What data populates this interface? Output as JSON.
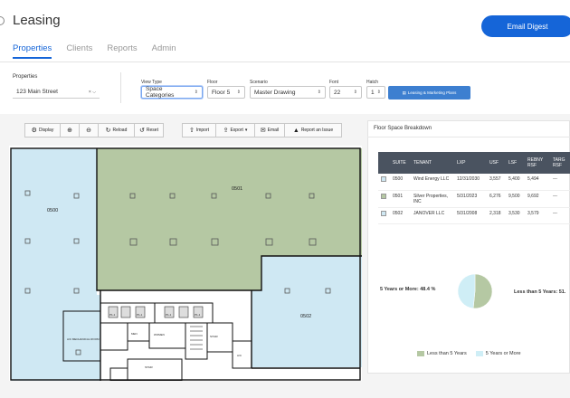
{
  "app": {
    "title": "Leasing",
    "email_digest_label": "Email Digest",
    "tabs": [
      {
        "label": "Properties",
        "active": true
      },
      {
        "label": "Clients",
        "active": false
      },
      {
        "label": "Reports",
        "active": false
      },
      {
        "label": "Admin",
        "active": false
      }
    ]
  },
  "filters": {
    "properties_label": "Properties",
    "properties_value": "123 Main Street",
    "view_type_label": "View Type",
    "view_type_value": "Space Categories",
    "floor_label": "Floor",
    "floor_value": "Floor 5",
    "scenario_label": "Scenario",
    "scenario_value": "Master Drawing",
    "font_label": "Font",
    "font_value": "22",
    "hatch_label": "Hatch",
    "hatch_value": "1",
    "plans_button": "Leasing & Marketing Plans"
  },
  "toolbar": {
    "display": "Display",
    "reload": "Reload",
    "reset": "Reset",
    "import": "Import",
    "export": "Export",
    "email": "Email",
    "report": "Report an Issue"
  },
  "floorplan": {
    "suites": [
      {
        "id": "0500",
        "color": "#cfe8f3"
      },
      {
        "id": "0501",
        "color": "#b5c8a3"
      },
      {
        "id": "0502",
        "color": "#cfe8f3"
      }
    ],
    "room_labels": {
      "ac_room": "A/C MECHANICAL ROOM",
      "men": "MEN",
      "women": "WOMEN",
      "stair": "STAIR",
      "stair_b": "STAIR",
      "ac": "A/C",
      "p1": "P1-1",
      "p2": "P1-1",
      "p3": "P1-1",
      "p4": "P1-1"
    }
  },
  "breakdown": {
    "title": "Floor Space Breakdown",
    "columns": [
      "",
      "SUITE",
      "TENANT",
      "LXP",
      "USF",
      "LSF",
      "REBNY RSF",
      "TARG RSF"
    ],
    "rows": [
      {
        "color": "#cfe8f3",
        "suite": "0500",
        "tenant": "Wind Energy LLC",
        "lxp": "12/31/2030",
        "usf": "3,557",
        "lsf": "5,400",
        "rebny": "5,494",
        "targ": "---"
      },
      {
        "color": "#b5c8a3",
        "suite": "0501",
        "tenant": "Silver Properties, INC",
        "lxp": "5/31/2023",
        "usf": "6,276",
        "lsf": "9,500",
        "rebny": "9,692",
        "targ": "---"
      },
      {
        "color": "#cfe8f3",
        "suite": "0502",
        "tenant": "JANOVER LLC",
        "lxp": "5/31/2008",
        "usf": "2,318",
        "lsf": "3,530",
        "rebny": "3,579",
        "targ": "---"
      }
    ]
  },
  "chart_data": {
    "type": "pie",
    "slices": [
      {
        "label": "Less than 5 Years",
        "value": 51.6,
        "color": "#b5c8a3",
        "display": "Less than 5 Years: 51."
      },
      {
        "label": "5 Years or More",
        "value": 48.4,
        "color": "#cfeef6",
        "display": "5 Years or More: 48.4 %"
      }
    ],
    "legend": [
      "Less than 5 Years",
      "5 Years or More"
    ],
    "legend_position": "bottom"
  }
}
